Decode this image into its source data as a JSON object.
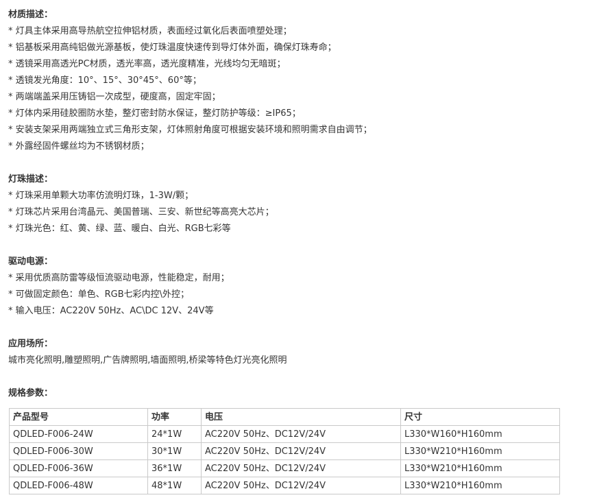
{
  "material": {
    "title": "材质描述：",
    "items": [
      "* 灯具主体采用高导热航空拉伸铝材质，表面经过氧化后表面喷塑处理；",
      "* 铝基板采用高纯铝做光源基板，使灯珠温度快速传到导灯体外面，确保灯珠寿命；",
      "* 透镜采用高透光PC材质，透光率高，透光度精准，光线均匀无暗斑；",
      "* 透镜发光角度：10°、15°、30°45°、60°等；",
      "* 两端端盖采用压铸铝一次成型，硬度高，固定牢固；",
      "* 灯体内采用硅胶圈防水垫，整灯密封防水保证，整灯防护等级：≥IP65；",
      "* 安装支架采用两端独立式三角形支架，灯体照射角度可根据安装环境和照明需求自由调节；",
      "* 外露经固件螺丝均为不锈钢材质；"
    ]
  },
  "led": {
    "title": "灯珠描述：",
    "items": [
      "* 灯珠采用单颗大功率仿流明灯珠，1-3W/颗；",
      "* 灯珠芯片采用台湾晶元、美国普瑞、三安、新世纪等高亮大芯片；",
      "* 灯珠光色：红、黄、绿、蓝、暖白、白光、RGB七彩等"
    ]
  },
  "driver": {
    "title": "驱动电源：",
    "items": [
      "* 采用优质高防雷等级恒流驱动电源，性能稳定，耐用；",
      "* 可做固定颜色：单色、RGB七彩内控\\外控；",
      "* 输入电压：AC220V 50Hz、AC\\DC 12V、24V等"
    ]
  },
  "application": {
    "title": "应用场所：",
    "text": "城市亮化照明,雕塑照明,广告牌照明,墙面照明,桥梁等特色灯光亮化照明"
  },
  "spec": {
    "title": "规格参数：",
    "headers": [
      "产品型号",
      "功率",
      "电压",
      "尺寸"
    ],
    "rows": [
      [
        "QDLED-F006-24W",
        "24*1W",
        "AC220V 50Hz、DC12V/24V",
        "L330*W160*H160mm"
      ],
      [
        "QDLED-F006-30W",
        "30*1W",
        "AC220V 50Hz、DC12V/24V",
        "L330*W210*H160mm"
      ],
      [
        "QDLED-F006-36W",
        "36*1W",
        "AC220V 50Hz、DC12V/24V",
        "L330*W210*H160mm"
      ],
      [
        "QDLED-F006-48W",
        "48*1W",
        "AC220V 50Hz、DC12V/24V",
        "L330*W210*H160mm"
      ]
    ]
  }
}
